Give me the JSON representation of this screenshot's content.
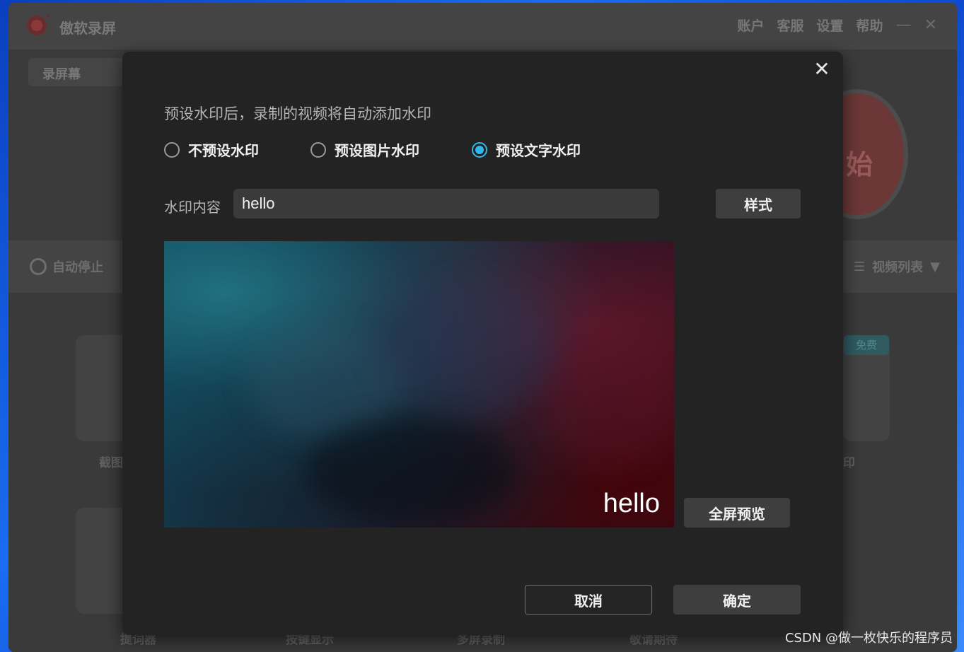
{
  "app": {
    "title": "傲软录屏",
    "menu": [
      "账户",
      "客服",
      "设置",
      "帮助"
    ],
    "minimize_glyph": "—",
    "close_glyph": "✕",
    "tab": "录屏幕",
    "record_button": "始",
    "auto_stop": "自动停止",
    "video_list": "视频列表",
    "free_badge": "免费",
    "ghost_labels": [
      "截图",
      "提词器",
      "按键显示",
      "多屏录制",
      "敬请期待",
      "印"
    ]
  },
  "dialog": {
    "close_glyph": "✕",
    "intro": "预设水印后，录制的视频将自动添加水印",
    "options": [
      {
        "label": "不预设水印",
        "checked": false
      },
      {
        "label": "预设图片水印",
        "checked": false
      },
      {
        "label": "预设文字水印",
        "checked": true
      }
    ],
    "watermark_label": "水印内容",
    "watermark_value": "hello",
    "style_button": "样式",
    "preview_watermark": "hello",
    "fullscreen_button": "全屏预览",
    "cancel_button": "取消",
    "ok_button": "确定",
    "accent_color": "#2fb8e8"
  },
  "footer": {
    "credit": "CSDN @做一枚快乐的程序员"
  }
}
